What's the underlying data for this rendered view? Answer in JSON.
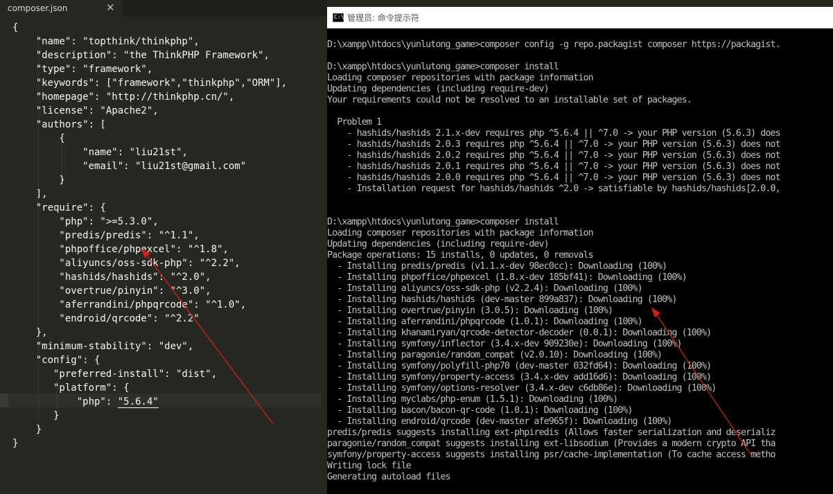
{
  "editor": {
    "tab_title": "composer.json",
    "tab_close": "✕",
    "lines": [
      "{",
      "    \"name\": \"topthink/thinkphp\",",
      "    \"description\": \"the ThinkPHP Framework\",",
      "    \"type\": \"framework\",",
      "    \"keywords\": [\"framework\",\"thinkphp\",\"ORM\"],",
      "    \"homepage\": \"http://thinkphp.cn/\",",
      "    \"license\": \"Apache2\",",
      "    \"authors\": [",
      "        {",
      "            \"name\": \"liu21st\",",
      "            \"email\": \"liu21st@gmail.com\"",
      "        }",
      "    ],",
      "    \"require\": {",
      "        \"php\": \">=5.3.0\",",
      "        \"predis/predis\": \"^1.1\",",
      "        \"phpoffice/phpexcel\": \"^1.8\",",
      "        \"aliyuncs/oss-sdk-php\": \"^2.2\",",
      "        \"hashids/hashids\": \"^2.0\",",
      "        \"overtrue/pinyin\": \"^3.0\",",
      "        \"aferrandini/phpqrcode\": \"^1.0\",",
      "        \"endroid/qrcode\": \"^2.2\"",
      "    },",
      "    \"minimum-stability\": \"dev\",",
      "    \"config\": {",
      "       \"preferred-install\": \"dist\",",
      "       \"platform\": {",
      "           \"php\": ",
      "       }",
      "    }",
      "}"
    ],
    "cursor_value": "\"5.6.4\""
  },
  "terminal": {
    "title": "管理员: 命令提示符",
    "icon_label": "C:\\",
    "lines": [
      "",
      "D:\\xampp\\htdocs\\yunlutong_game>composer config -g repo.packagist composer https://packagist.",
      "",
      "D:\\xampp\\htdocs\\yunlutong_game>composer install",
      "Loading composer repositories with package information",
      "Updating dependencies (including require-dev)",
      "Your requirements could not be resolved to an installable set of packages.",
      "",
      "  Problem 1",
      "    - hashids/hashids 2.1.x-dev requires php ^5.6.4 || ^7.0 -> your PHP version (5.6.3) does",
      "    - hashids/hashids 2.0.3 requires php ^5.6.4 || ^7.0 -> your PHP version (5.6.3) does not",
      "    - hashids/hashids 2.0.2 requires php ^5.6.4 || ^7.0 -> your PHP version (5.6.3) does not",
      "    - hashids/hashids 2.0.1 requires php ^5.6.4 || ^7.0 -> your PHP version (5.6.3) does not",
      "    - hashids/hashids 2.0.0 requires php ^5.6.4 || ^7.0 -> your PHP version (5.6.3) does not",
      "    - Installation request for hashids/hashids ^2.0 -> satisfiable by hashids/hashids[2.0.0,",
      "",
      "",
      "D:\\xampp\\htdocs\\yunlutong_game>composer install",
      "Loading composer repositories with package information",
      "Updating dependencies (including require-dev)",
      "Package operations: 15 installs, 0 updates, 0 removals",
      "  - Installing predis/predis (v1.1.x-dev 98ec0cc): Downloading (100%)",
      "  - Installing phpoffice/phpexcel (1.8.x-dev 185bf41): Downloading (100%)",
      "  - Installing aliyuncs/oss-sdk-php (v2.2.4): Downloading (100%)",
      "  - Installing hashids/hashids (dev-master 899a837): Downloading (100%)",
      "  - Installing overtrue/pinyin (3.0.5): Downloading (100%)",
      "  - Installing aferrandini/phpqrcode (1.0.1): Downloading (100%)",
      "  - Installing khanamiryan/qrcode-detector-decoder (0.0.1): Downloading (100%)",
      "  - Installing symfony/inflector (3.4.x-dev 909230e): Downloading (100%)",
      "  - Installing paragonie/random_compat (v2.0.10): Downloading (100%)",
      "  - Installing symfony/polyfill-php70 (dev-master 032fd64): Downloading (100%)",
      "  - Installing symfony/property-access (3.4.x-dev add16d6): Downloading (100%)",
      "  - Installing symfony/options-resolver (3.4.x-dev c6db86e): Downloading (100%)",
      "  - Installing myclabs/php-enum (1.5.1): Downloading (100%)",
      "  - Installing bacon/bacon-qr-code (1.0.1): Downloading (100%)",
      "  - Installing endroid/qrcode (dev-master afe965f): Downloading (100%)",
      "predis/predis suggests installing ext-phpiredis (Allows faster serialization and deserializ",
      "paragonie/random_compat suggests installing ext-libsodium (Provides a modern crypto API tha",
      "symfony/property-access suggests installing psr/cache-implementation (To cache access metho",
      "Writing lock file",
      "Generating autoload files"
    ]
  },
  "colors": {
    "editor_bg": "#272822",
    "editor_text": "#f8f8f2",
    "terminal_bg": "#000000",
    "terminal_text": "#c0c0c0",
    "annotation_arrow": "#d0201a"
  }
}
